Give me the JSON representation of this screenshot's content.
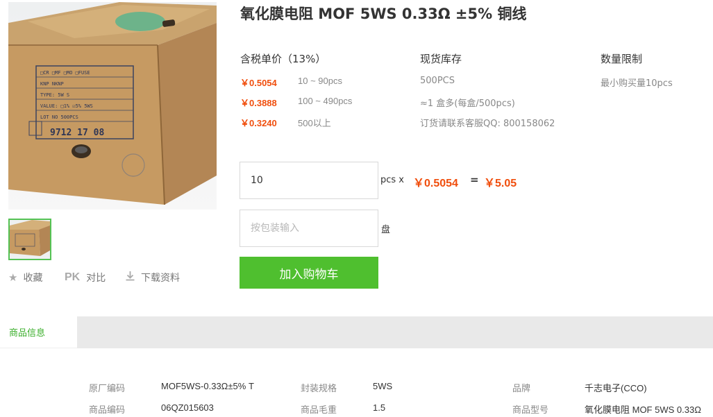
{
  "product": {
    "title": "氧化膜电阻 MOF 5WS 0.33Ω ±5% 铜线"
  },
  "gallery": {
    "box_label_lines": [
      "CR",
      "MF",
      "MO",
      "FUSE",
      "KNP",
      "NKNP",
      "TYPE:",
      "5W S",
      "VALUE:",
      "5WS",
      "500PCS"
    ],
    "box_lot": "9712 17 08"
  },
  "actions": {
    "favorite": "收藏",
    "pk_badge": "PK",
    "compare": "对比",
    "download": "下载资料"
  },
  "pricing": {
    "header": "含税单价（13%）",
    "tiers": [
      {
        "price": "￥0.5054",
        "range": "10 ~ 90pcs"
      },
      {
        "price": "￥0.3888",
        "range": "100 ~ 490pcs"
      },
      {
        "price": "￥0.3240",
        "range": "500以上"
      }
    ]
  },
  "stock": {
    "header": "现货库存",
    "lines": [
      "500PCS",
      "≈1 盒多(每盒/500pcs)",
      "订货请联系客服QQ: 800158062"
    ]
  },
  "limit": {
    "header": "数量限制",
    "text": "最小购买量10pcs"
  },
  "order": {
    "quantity_value": "10",
    "unit_times": "pcs x",
    "unit_price": "￥0.5054",
    "equals": "=",
    "total": "￥5.05",
    "package_placeholder": "按包装输入",
    "package_unit": "盘",
    "cart_button": "加入购物车"
  },
  "info": {
    "tab_label": "商品信息",
    "specs": [
      {
        "label": "原厂编码",
        "value": "MOF5WS-0.33Ω±5% T"
      },
      {
        "label": "封装规格",
        "value": "5WS"
      },
      {
        "label": "品牌",
        "value": "千志电子(CCO)"
      },
      {
        "label": "商品编码",
        "value": "06QZ015603"
      },
      {
        "label": "商品毛重",
        "value": "1.5"
      },
      {
        "label": "商品型号",
        "value": "氧化膜电阻 MOF 5WS 0.33Ω"
      }
    ]
  },
  "colors": {
    "accent_green": "#4fbf2f",
    "price_orange": "#f04e0d",
    "tab_green": "#3aae2a"
  }
}
